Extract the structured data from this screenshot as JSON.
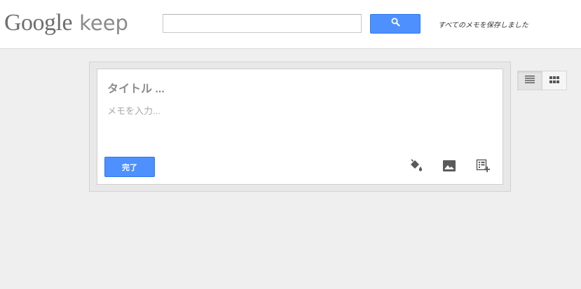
{
  "app": {
    "logo_google": "Google",
    "logo_keep": "keep"
  },
  "header": {
    "search_placeholder": "",
    "search_value": "",
    "search_icon": "search-icon",
    "save_status": "すべてのメモを保存しました"
  },
  "note": {
    "title_placeholder": "タイトル ...",
    "body_placeholder": "メモを入力...",
    "done_label": "完了",
    "tools": [
      "color-fill-icon",
      "image-icon",
      "checklist-icon"
    ]
  },
  "view_toggle": {
    "options": [
      "list-view-icon",
      "grid-view-icon"
    ],
    "selected": "list-view-icon"
  },
  "colors": {
    "accent": "#4d90fe",
    "background": "#efefef"
  }
}
